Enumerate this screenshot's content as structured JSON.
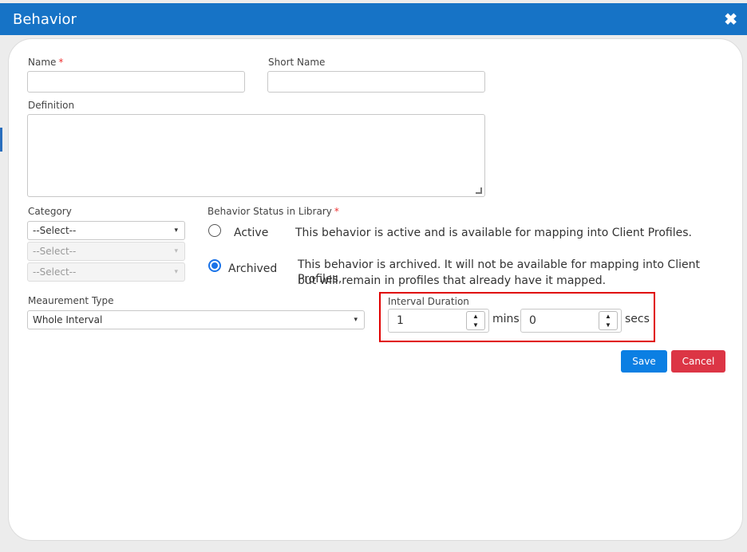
{
  "window": {
    "title": "Behavior",
    "close_glyph": "✖"
  },
  "form": {
    "name_label": "Name",
    "required_mark": "*",
    "short_name_label": "Short Name",
    "definition_label": "Definition",
    "category_label": "Category",
    "category_select_1": "--Select--",
    "category_select_2": "--Select--",
    "category_select_3": "--Select--",
    "status_label": "Behavior Status in Library",
    "status_options": [
      {
        "label": "Active",
        "description": "This behavior is active and is available for mapping into Client Profiles.",
        "checked": false
      },
      {
        "label": "Archived",
        "description_line1": "This behavior is archived. It will not be available for mapping into Client Profiles,",
        "description_line2": "but will remain in profiles that already have it mapped.",
        "checked": true
      }
    ],
    "measurement_label": "Meaurement Type",
    "measurement_value": "Whole Interval",
    "interval_label": "Interval Duration",
    "interval_mins_value": "1",
    "interval_mins_unit": "mins",
    "interval_secs_value": "0",
    "interval_secs_unit": "secs"
  },
  "buttons": {
    "save": "Save",
    "cancel": "Cancel"
  },
  "colors": {
    "titlebar": "#1673c6",
    "save": "#0b7fe3",
    "cancel": "#dc3545",
    "highlight": "#e00000",
    "radio_checked": "#1a73e8"
  },
  "icons": {
    "caret": "▾",
    "spin_up": "▲",
    "spin_down": "▼"
  }
}
